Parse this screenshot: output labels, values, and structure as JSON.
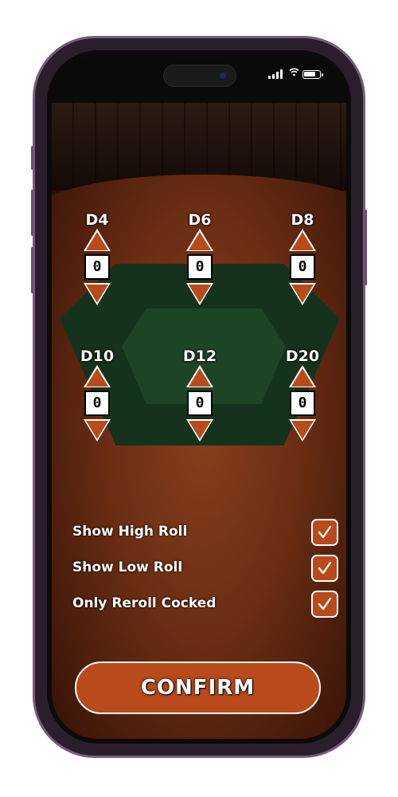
{
  "status_bar": {
    "signal_icon": "cellular-signal-icon",
    "wifi_icon": "wifi-icon",
    "battery_icon": "battery-icon"
  },
  "dice": [
    {
      "name": "D4",
      "count": "0"
    },
    {
      "name": "D6",
      "count": "0"
    },
    {
      "name": "D8",
      "count": "0"
    },
    {
      "name": "D10",
      "count": "0"
    },
    {
      "name": "D12",
      "count": "0"
    },
    {
      "name": "D20",
      "count": "0"
    }
  ],
  "options": [
    {
      "label": "Show High Roll",
      "checked": true
    },
    {
      "label": "Show Low Roll",
      "checked": true
    },
    {
      "label": "Only Reroll Cocked",
      "checked": true
    }
  ],
  "confirm_label": "CONFIRM",
  "colors": {
    "accent": "#b84a1c",
    "felt": "#1e4426",
    "wood": "#6a2e13"
  }
}
